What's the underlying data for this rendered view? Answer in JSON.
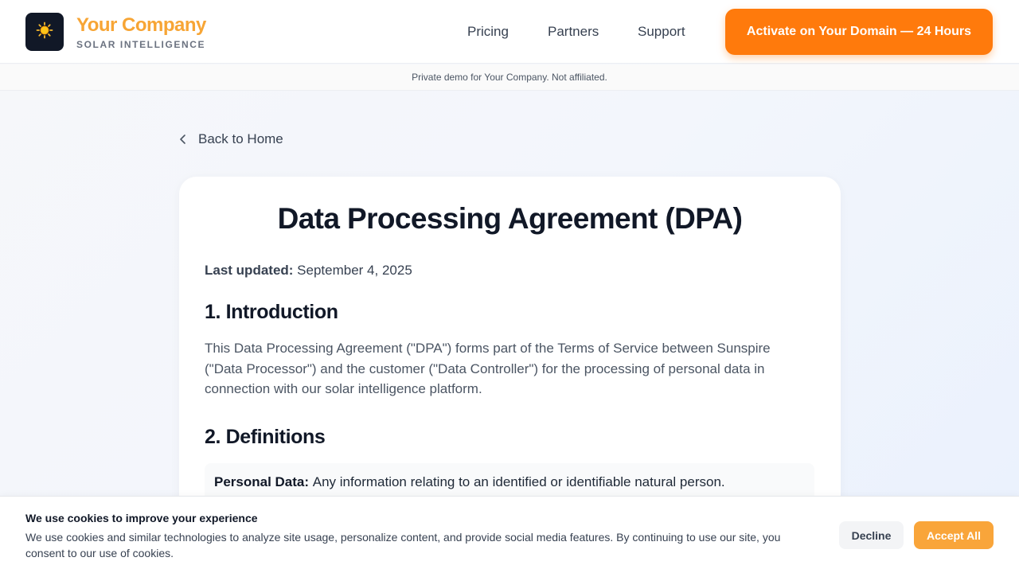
{
  "header": {
    "logo_icon": "sun-icon",
    "brand_name": "Your Company",
    "brand_tagline": "SOLAR INTELLIGENCE",
    "nav": {
      "pricing": "Pricing",
      "partners": "Partners",
      "support": "Support"
    },
    "cta_label": "Activate on Your Domain — 24 Hours"
  },
  "notice": "Private demo for Your Company. Not affiliated.",
  "back_link": {
    "icon": "chevron-left-icon",
    "label": "Back to Home"
  },
  "document": {
    "title": "Data Processing Agreement (DPA)",
    "last_updated_label": "Last updated:",
    "last_updated_value": "September 4, 2025",
    "sections": [
      {
        "heading": "1. Introduction",
        "body": "This Data Processing Agreement (\"DPA\") forms part of the Terms of Service between Sunspire (\"Data Processor\") and the customer (\"Data Controller\") for the processing of personal data in connection with our solar intelligence platform."
      },
      {
        "heading": "2. Definitions",
        "definitions": [
          {
            "term": "Personal Data:",
            "text": "Any information relating to an identified or identifiable natural person."
          }
        ]
      }
    ]
  },
  "cookie_banner": {
    "title": "We use cookies to improve your experience",
    "text": "We use cookies and similar technologies to analyze site usage, personalize content, and provide social media features. By continuing to use our site, you consent to our use of cookies.",
    "decline_label": "Decline",
    "accept_label": "Accept All"
  },
  "colors": {
    "brand": "#f7a535",
    "cta": "#ff7a0c",
    "accept": "#f9a53a",
    "logo_bg": "#111827"
  }
}
